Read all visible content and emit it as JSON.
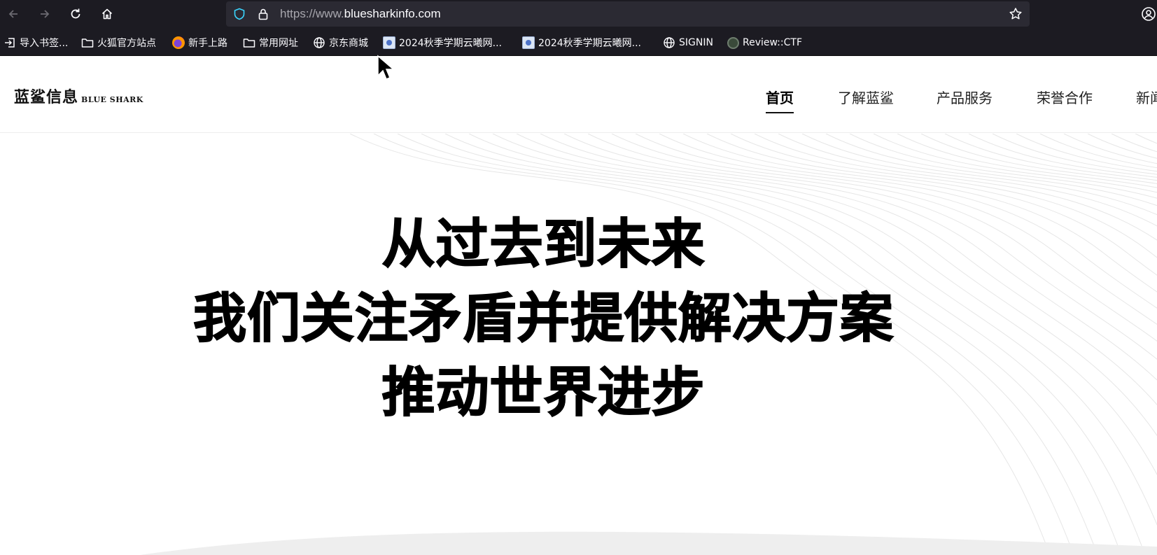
{
  "browser": {
    "url_prefix": "https://www.",
    "url_domain": "bluesharkinfo.com",
    "bookmarks": [
      {
        "label": "导入书签...",
        "icon": "import-icon"
      },
      {
        "label": "火狐官方站点",
        "icon": "folder-icon"
      },
      {
        "label": "新手上路",
        "icon": "firefox-icon"
      },
      {
        "label": "常用网址",
        "icon": "folder-icon"
      },
      {
        "label": "京东商城",
        "icon": "globe-icon"
      },
      {
        "label": "2024秋季学期云曦网...",
        "icon": "site-favicon"
      },
      {
        "label": "2024秋季学期云曦网...",
        "icon": "site-favicon"
      },
      {
        "label": "SIGNIN",
        "icon": "globe-icon"
      },
      {
        "label": "Review::CTF",
        "icon": "ctf-favicon"
      }
    ]
  },
  "site": {
    "logo_cn": "蓝鲨信息",
    "logo_en": "BLUE SHARK",
    "nav": [
      {
        "label": "首页",
        "active": true
      },
      {
        "label": "了解蓝鲨",
        "active": false
      },
      {
        "label": "产品服务",
        "active": false
      },
      {
        "label": "荣誉合作",
        "active": false
      },
      {
        "label": "新闻",
        "active": false
      }
    ]
  },
  "hero": {
    "lines": [
      "从过去到未来",
      "我们关注矛盾并提供解决方案",
      "推动世界进步"
    ]
  },
  "colors": {
    "chrome_bg": "#1c1b22",
    "urlbar_bg": "#2b2a33",
    "shield": "#0df",
    "hero_text": "#000000"
  }
}
